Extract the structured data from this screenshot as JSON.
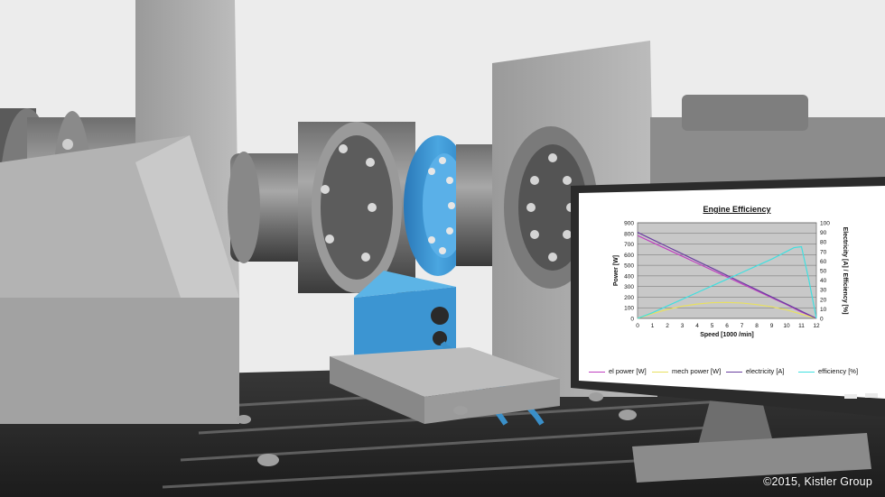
{
  "chart_data": {
    "type": "line",
    "title": "Engine Efficiency",
    "xlabel": "Speed  [1000 /min]",
    "ylabel_left": "Power [W]",
    "ylabel_right": "Electricity [A] / Efficiency  [%]",
    "x_ticks": [
      "0",
      "1",
      "2",
      "3",
      "4",
      "5",
      "6",
      "7",
      "8",
      "9",
      "10",
      "11",
      "12"
    ],
    "y_left_ticks": [
      "0",
      "100",
      "200",
      "300",
      "400",
      "500",
      "600",
      "700",
      "800",
      "900"
    ],
    "y_right_ticks": [
      "0",
      "10",
      "20",
      "30",
      "40",
      "50",
      "60",
      "70",
      "80",
      "90",
      "100"
    ],
    "xlim": [
      0,
      12
    ],
    "ylim_left": [
      0,
      900
    ],
    "ylim_right": [
      0,
      100
    ],
    "grid": true,
    "legend": "bottom",
    "series": [
      {
        "name": "el power [W]",
        "axis": "left",
        "color": "#c040c0",
        "x": [
          0,
          1,
          2,
          3,
          4,
          5,
          6,
          7,
          8,
          9,
          10,
          11,
          11.5,
          12
        ],
        "y": [
          780,
          715,
          650,
          585,
          520,
          455,
          390,
          325,
          260,
          195,
          130,
          60,
          30,
          0
        ]
      },
      {
        "name": "mech power [W]",
        "axis": "left",
        "color": "#e8e060",
        "x": [
          0,
          1,
          2,
          3,
          4,
          5,
          6,
          7,
          8,
          9,
          10,
          11,
          12
        ],
        "y": [
          0,
          45,
          85,
          115,
          135,
          148,
          150,
          145,
          130,
          110,
          80,
          40,
          0
        ]
      },
      {
        "name": "electricity [A]",
        "axis": "right",
        "color": "#6a3fa0",
        "x": [
          0,
          1,
          2,
          3,
          4,
          5,
          6,
          7,
          8,
          9,
          10,
          11,
          12
        ],
        "y": [
          90,
          82.5,
          75,
          67.5,
          60,
          52.5,
          45,
          37.5,
          30,
          22.5,
          15,
          7.5,
          0
        ]
      },
      {
        "name": "efficiency [%]",
        "axis": "right",
        "color": "#40e0e0",
        "x": [
          0,
          1,
          2,
          3,
          4,
          5,
          6,
          7,
          8,
          9,
          10,
          10.5,
          11,
          11.5,
          12
        ],
        "y": [
          0,
          6,
          13,
          20,
          27,
          34,
          41,
          48,
          55,
          62,
          70,
          74,
          75,
          40,
          0
        ]
      }
    ]
  },
  "copyright": "©2015, Kistler Group"
}
